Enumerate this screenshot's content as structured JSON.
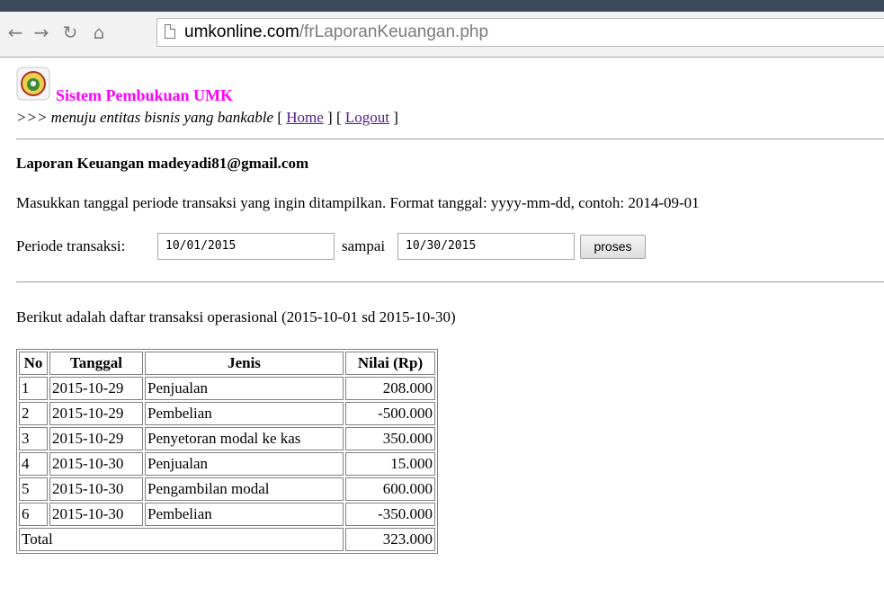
{
  "browser": {
    "url_host": "umkonline.com",
    "url_path": "/frLaporanKeuangan.php",
    "icons": [
      "back-icon",
      "forward-icon",
      "reload-icon",
      "home-icon",
      "page-icon"
    ]
  },
  "header": {
    "site_title": "Sistem Pembukuan UMK",
    "tagline_prefix": ">>> menuju entitas bisnis yang bankable",
    "home_link": "Home",
    "logout_link": "Logout"
  },
  "report": {
    "title": "Laporan Keuangan madeyadi81@gmail.com",
    "instructions": "Masukkan tanggal periode transaksi yang ingin ditampilkan. Format tanggal: yyyy-mm-dd, contoh: 2014-09-01",
    "period_label": "Periode transaksi:",
    "date_from": "10/01/2015",
    "to_label": "sampai",
    "date_to": "10/30/2015",
    "submit_label": "proses",
    "list_intro": "Berikut adalah daftar transaksi operasional (2015-10-01 sd 2015-10-30)"
  },
  "table": {
    "headers": [
      "No",
      "Tanggal",
      "Jenis",
      "Nilai (Rp)"
    ],
    "rows": [
      {
        "no": "1",
        "tanggal": "2015-10-29",
        "jenis": "Penjualan",
        "nilai": "208.000"
      },
      {
        "no": "2",
        "tanggal": "2015-10-29",
        "jenis": "Pembelian",
        "nilai": "-500.000"
      },
      {
        "no": "3",
        "tanggal": "2015-10-29",
        "jenis": "Penyetoran modal ke kas",
        "nilai": "350.000"
      },
      {
        "no": "4",
        "tanggal": "2015-10-30",
        "jenis": "Penjualan",
        "nilai": "15.000"
      },
      {
        "no": "5",
        "tanggal": "2015-10-30",
        "jenis": "Pengambilan modal",
        "nilai": "600.000"
      },
      {
        "no": "6",
        "tanggal": "2015-10-30",
        "jenis": "Pembelian",
        "nilai": "-350.000"
      }
    ],
    "total_label": "Total",
    "total_value": "323.000"
  },
  "colors": {
    "title": "#ff00ff",
    "link": "#551a8b"
  }
}
